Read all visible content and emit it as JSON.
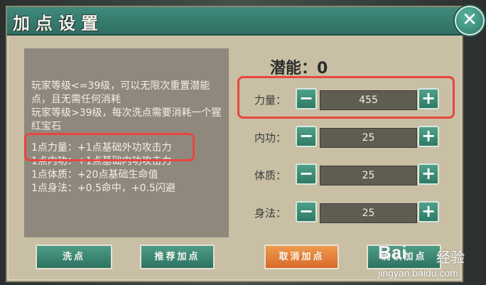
{
  "window": {
    "title": "加点设置",
    "close_glyph": "✕"
  },
  "description": {
    "intro": "玩家等级<=39级，可以无限次重置潜能点，且无需任何消耗\n玩家等级>39级，每次洗点需要消耗一个猩红宝石",
    "effects": [
      "1点力量：+1点基础外功攻击力",
      "1点内功：+1点基础内功攻击力",
      "1点体质：+20点基础生命值",
      "1点身法：+0.5命中，+0.5闪避"
    ]
  },
  "potential": {
    "label": "潜能：0"
  },
  "stats": [
    {
      "label": "力量：",
      "value": "455"
    },
    {
      "label": "内功：",
      "value": "25"
    },
    {
      "label": "体质：",
      "value": "25"
    },
    {
      "label": "身法：",
      "value": "25"
    }
  ],
  "controls": {
    "minus": "−",
    "plus": "+"
  },
  "buttons": {
    "reset": "洗点",
    "recommend": "推荐加点",
    "cancel": "取消加点",
    "confirm": "确认加点"
  },
  "watermark": {
    "brand": "Bai",
    "brand_suffix": "经验",
    "url": "jingyan.baidu.com"
  },
  "colors": {
    "highlight": "#e8463f",
    "accent_teal": "#2e7a65",
    "accent_orange": "#d9692a"
  }
}
